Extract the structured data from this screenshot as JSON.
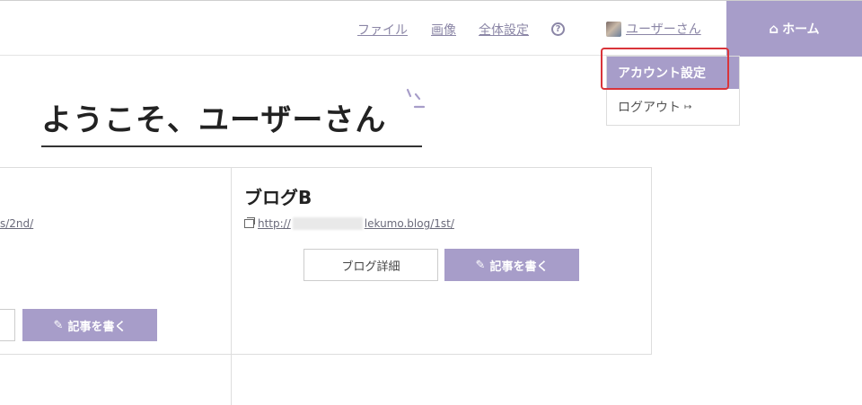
{
  "header": {
    "nav": [
      {
        "label": "ファイル"
      },
      {
        "label": "画像"
      },
      {
        "label": "全体設定"
      }
    ],
    "help_icon": "?",
    "user_label": "ユーザーさん",
    "home_label": "ホーム",
    "home_icon": "⌂"
  },
  "dropdown": {
    "account_settings": "アカウント設定",
    "logout": "ログアウト",
    "logout_icon": "↦"
  },
  "welcome": {
    "title": "ようこそ、ユーザーさん"
  },
  "cards": {
    "left": {
      "url_fragment": "s/2nd/",
      "write_label": "記事を書く"
    },
    "right": {
      "title": "ブログB",
      "url_prefix": "http://",
      "url_suffix": "lekumo.blog/1st/",
      "detail_label": "ブログ詳細",
      "write_label": "記事を書く"
    }
  },
  "colors": {
    "accent": "#a79dc9",
    "link": "#8b86a6",
    "highlight": "#d9343a"
  }
}
